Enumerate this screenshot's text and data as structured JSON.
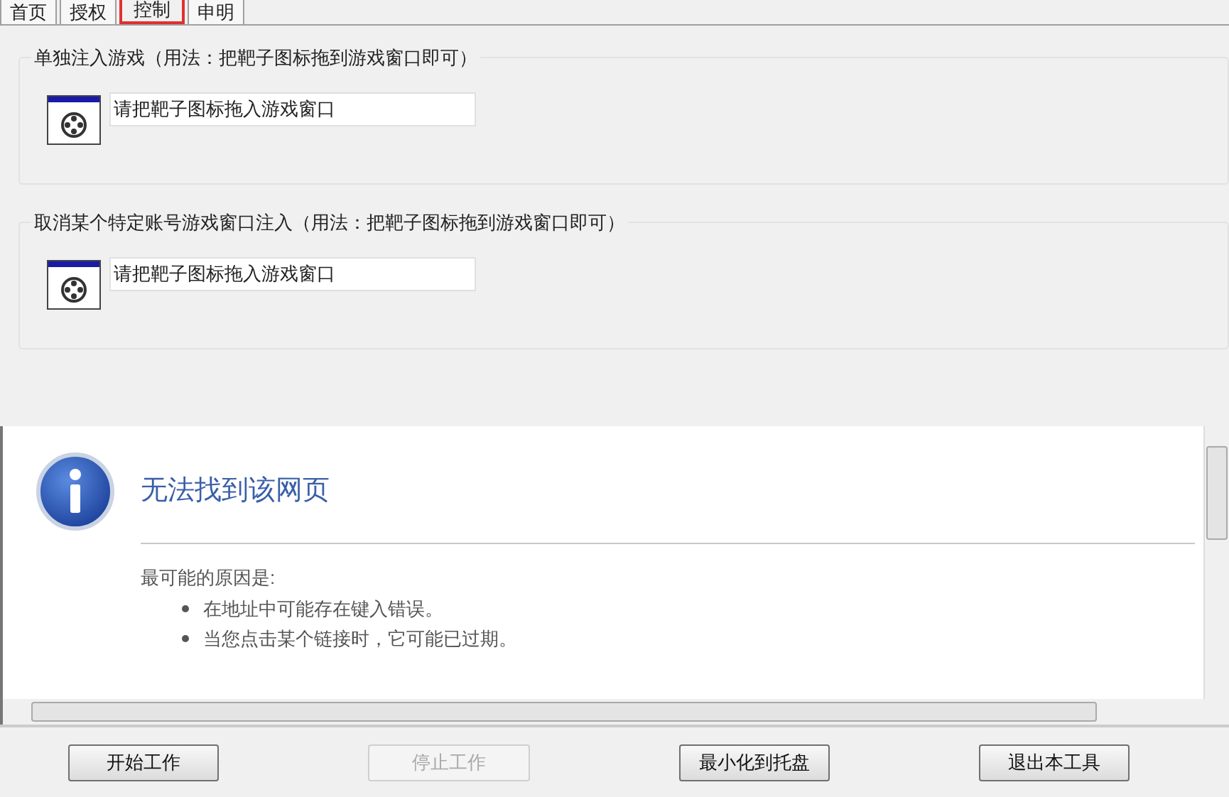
{
  "tabs": [
    {
      "label": "首页",
      "selected": false
    },
    {
      "label": "授权",
      "selected": false
    },
    {
      "label": "控制",
      "selected": true
    },
    {
      "label": "申明",
      "selected": false
    }
  ],
  "groups": [
    {
      "label": "单独注入游戏（用法：把靶子图标拖到游戏窗口即可）",
      "value": "请把靶子图标拖入游戏窗口"
    },
    {
      "label": "取消某个特定账号游戏窗口注入（用法：把靶子图标拖到游戏窗口即可）",
      "value": "请把靶子图标拖入游戏窗口"
    }
  ],
  "browser": {
    "title": "无法找到该网页",
    "intro": "最可能的原因是:",
    "reasons": [
      "在地址中可能存在键入错误。",
      "当您点击某个链接时，它可能已过期。"
    ]
  },
  "buttons": [
    {
      "label": "开始工作",
      "disabled": false
    },
    {
      "label": "停止工作",
      "disabled": true
    },
    {
      "label": "最小化到托盘",
      "disabled": false
    },
    {
      "label": "退出本工具",
      "disabled": false
    }
  ]
}
